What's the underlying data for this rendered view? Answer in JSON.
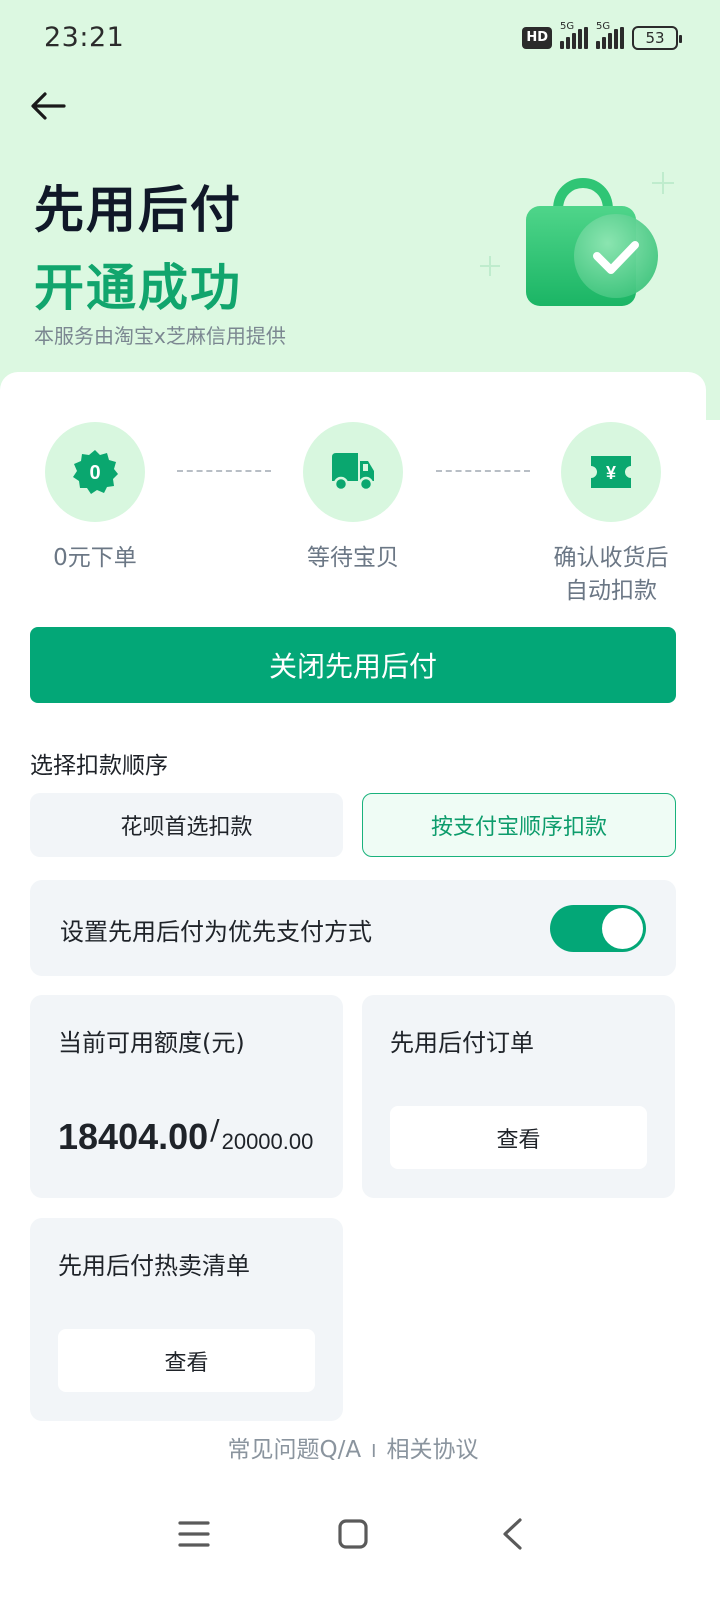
{
  "status_bar": {
    "time": "23:21",
    "hd_label": "HD",
    "net1": "5G",
    "net2": "5G",
    "battery": "53"
  },
  "header": {
    "title_line1": "先用后付",
    "title_line2": "开通成功",
    "provider": "本服务由淘宝x芝麻信用提供"
  },
  "steps": [
    {
      "icon": "zero-badge-icon",
      "badge": "0",
      "label": "0元下单"
    },
    {
      "icon": "truck-icon",
      "label": "等待宝贝"
    },
    {
      "icon": "yen-ticket-icon",
      "badge": "¥",
      "label_line1": "确认收货后",
      "label_line2": "自动扣款"
    }
  ],
  "close_button": "关闭先用后付",
  "deduction": {
    "label": "选择扣款顺序",
    "options": [
      "花呗首选扣款",
      "按支付宝顺序扣款"
    ],
    "selected": "按支付宝顺序扣款"
  },
  "preferred_payment": {
    "label": "设置先用后付为优先支付方式",
    "enabled": true
  },
  "credit": {
    "title": "当前可用额度(元)",
    "available": "18404.00",
    "separator": "/",
    "total": "20000.00"
  },
  "orders": {
    "title": "先用后付订单",
    "view": "查看"
  },
  "hot_list": {
    "title": "先用后付热卖清单",
    "view": "查看"
  },
  "footer": {
    "faq": "常见问题Q/A",
    "separator": "I",
    "agreement": "相关协议"
  },
  "colors": {
    "brand_green": "#03a777",
    "hero_bg": "#dcf8e1",
    "title_green": "#11a56d"
  }
}
